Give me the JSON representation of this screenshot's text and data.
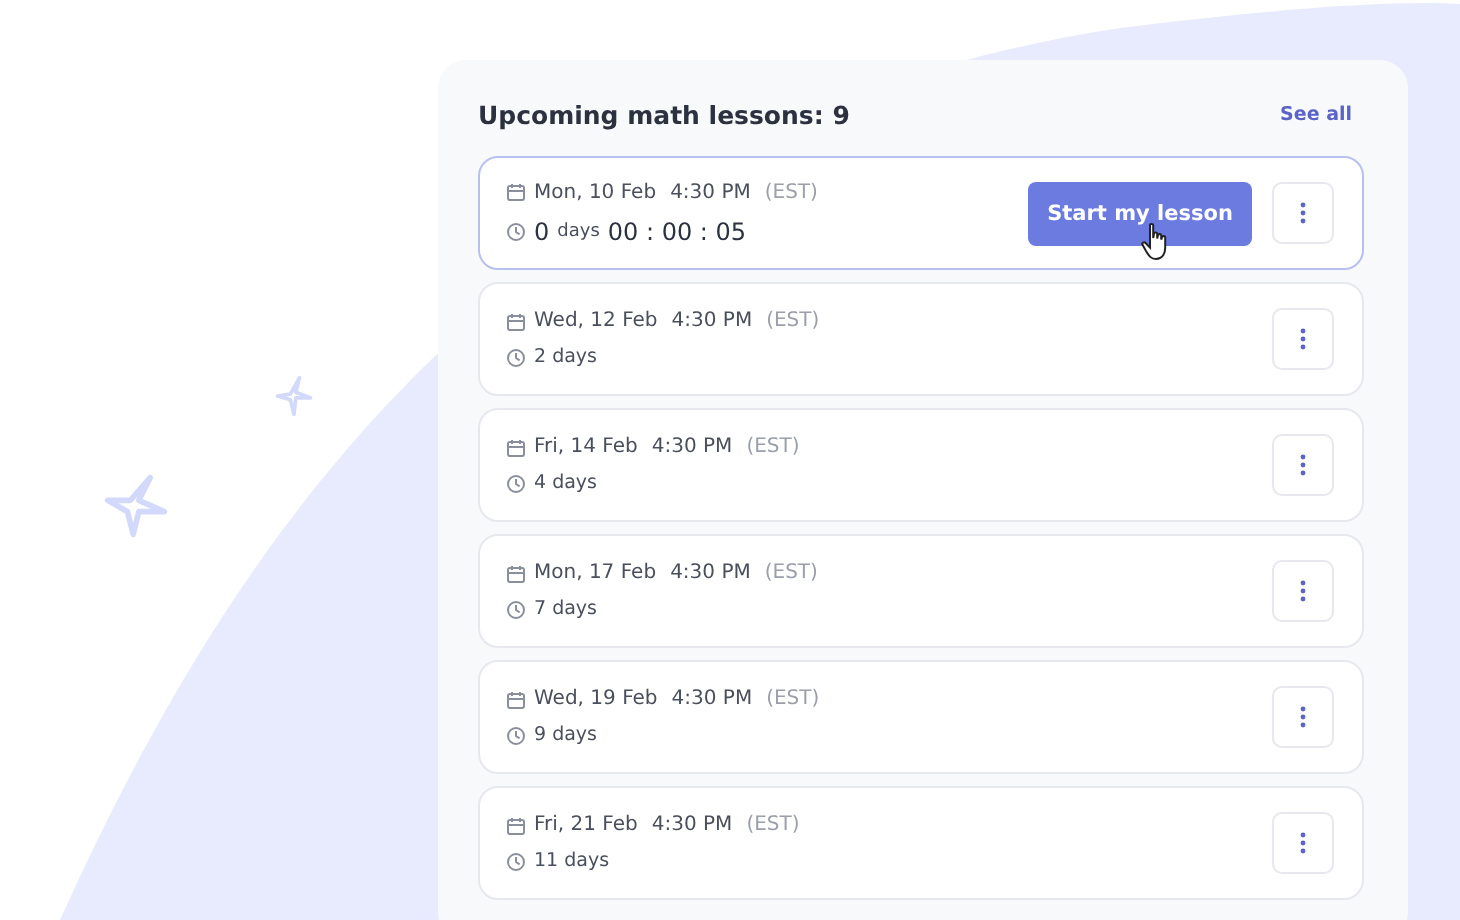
{
  "header": {
    "title": "Upcoming math lessons: 9",
    "link": "See all"
  },
  "lessons": [
    {
      "kind": "next",
      "selected": true,
      "date": "Mon, 10 Feb",
      "time": "4:30 PM",
      "timezone": "(EST)",
      "days": "0",
      "days_unit": "days",
      "countdown": "00 : 00 : 05",
      "button": "Start my lesson"
    },
    {
      "kind": "later",
      "selected": false,
      "date": "Wed, 12 Feb",
      "time": "4:30 PM",
      "timezone": "(EST)",
      "remaining": "2 days"
    },
    {
      "kind": "later",
      "selected": false,
      "date": "Fri, 14 Feb",
      "time": "4:30 PM",
      "timezone": "(EST)",
      "remaining": "4 days"
    },
    {
      "kind": "later",
      "selected": false,
      "date": "Mon, 17 Feb",
      "time": "4:30 PM",
      "timezone": "(EST)",
      "remaining": "7 days"
    },
    {
      "kind": "later",
      "selected": false,
      "date": "Wed, 19 Feb",
      "time": "4:30 PM",
      "timezone": "(EST)",
      "remaining": "9 days"
    },
    {
      "kind": "later",
      "selected": false,
      "date": "Fri, 21 Feb",
      "time": "4:30 PM",
      "timezone": "(EST)",
      "remaining": "11 days"
    }
  ]
}
